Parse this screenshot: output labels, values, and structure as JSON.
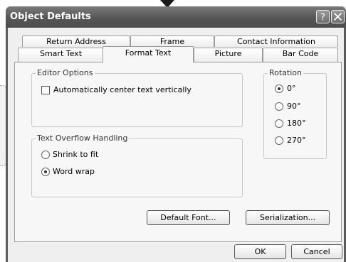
{
  "window": {
    "title": "Object Defaults",
    "help_label": "?",
    "close_label": "X"
  },
  "tabs": {
    "row1": [
      "Return Address",
      "Frame",
      "Contact Information"
    ],
    "row2": [
      "Smart Text",
      "Format Text",
      "Picture",
      "Bar Code"
    ],
    "active": "Format Text"
  },
  "editor_options": {
    "legend": "Editor Options",
    "center_text_label": "Automatically center text vertically",
    "center_text_checked": false
  },
  "rotation": {
    "legend": "Rotation",
    "options": [
      "0°",
      "90°",
      "180°",
      "270°"
    ],
    "selected": "0°"
  },
  "overflow": {
    "legend": "Text Overflow Handling",
    "options": [
      "Shrink to fit",
      "Word wrap"
    ],
    "selected": "Word wrap"
  },
  "buttons": {
    "default_font": "Default Font...",
    "serialization": "Serialization...",
    "ok": "OK",
    "cancel": "Cancel"
  },
  "colors": {
    "titlebar": "#5c5c5c",
    "dialog_bg": "#efefef"
  }
}
